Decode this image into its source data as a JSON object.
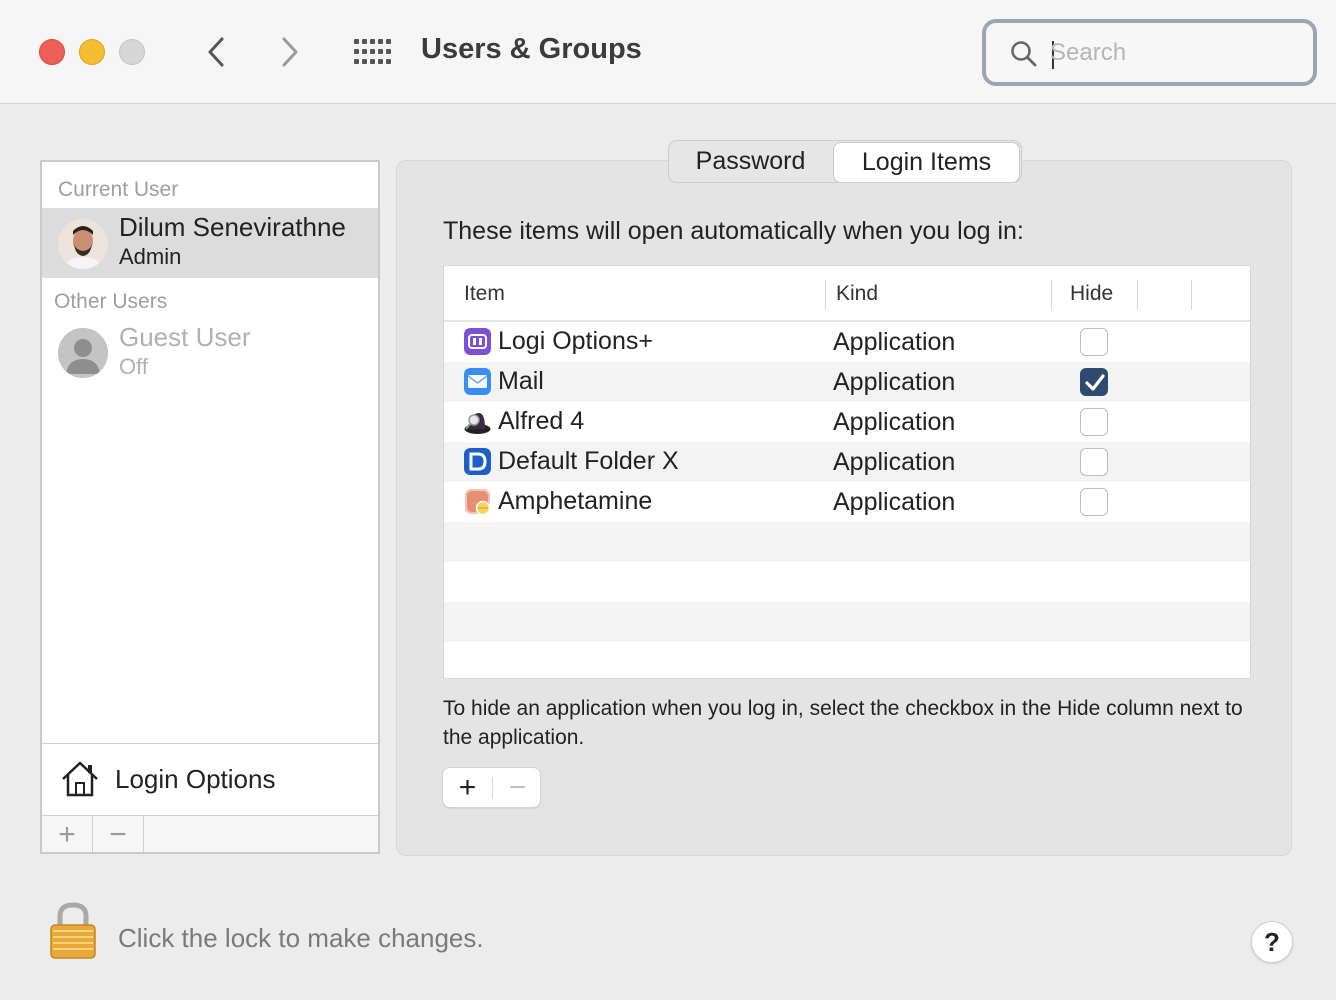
{
  "window": {
    "title": "Users & Groups",
    "search_placeholder": "Search"
  },
  "sidebar": {
    "current_user_label": "Current User",
    "current_user": {
      "name": "Dilum Senevirathne",
      "role": "Admin"
    },
    "other_users_label": "Other Users",
    "other_user": {
      "name": "Guest User",
      "role": "Off"
    },
    "login_options_label": "Login Options",
    "add_label": "+",
    "remove_label": "−"
  },
  "tabs": [
    {
      "label": "Password",
      "selected": false
    },
    {
      "label": "Login Items",
      "selected": true
    }
  ],
  "main": {
    "intro": "These items will open automatically when you log in:",
    "columns": {
      "item": "Item",
      "kind": "Kind",
      "hide": "Hide"
    },
    "rows": [
      {
        "name": "Logi Options+",
        "kind": "Application",
        "hide": false,
        "icon": "logi-options-icon"
      },
      {
        "name": "Mail",
        "kind": "Application",
        "hide": true,
        "icon": "mail-icon"
      },
      {
        "name": "Alfred 4",
        "kind": "Application",
        "hide": false,
        "icon": "alfred-icon"
      },
      {
        "name": "Default Folder X",
        "kind": "Application",
        "hide": false,
        "icon": "default-folder-icon"
      },
      {
        "name": "Amphetamine",
        "kind": "Application",
        "hide": false,
        "icon": "amphetamine-icon"
      }
    ],
    "help": "To hide an application when you log in, select the checkbox in the Hide column next to the application.",
    "add_label": "+",
    "remove_label": "−"
  },
  "footer": {
    "lock_text": "Click the lock to make changes.",
    "help_label": "?"
  },
  "colors": {
    "close": "#ed5f57",
    "minimize": "#f5bd33",
    "search_focus": "#98a7b8",
    "checkbox_checked": "#2f4a6e"
  }
}
